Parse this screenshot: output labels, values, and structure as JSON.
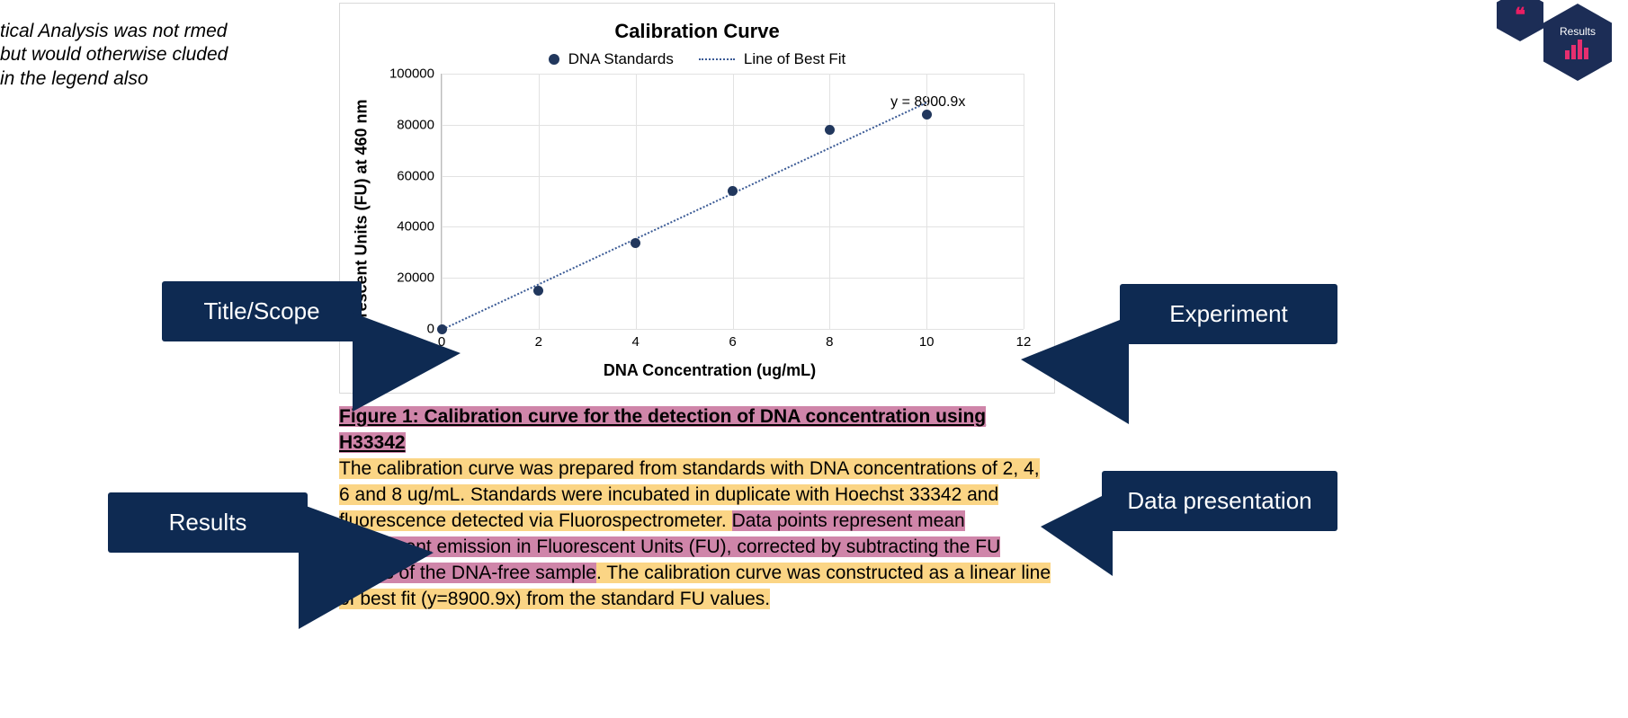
{
  "cut_note": "tical Analysis was not rmed but would otherwise cluded in the legend also",
  "hex_badge_label": "Results",
  "chart": {
    "title": "Calibration Curve",
    "legend": {
      "series_a": "DNA Standards",
      "series_b": "Line of Best Fit"
    },
    "y_label": "Fluorescent Units (FU) at 460 nm",
    "x_label": "DNA Concentration (ug/mL)",
    "equation": "y = 8900.9x",
    "x_ticks": [
      "0",
      "2",
      "4",
      "6",
      "8",
      "10",
      "12"
    ],
    "y_ticks": [
      "0",
      "20000",
      "40000",
      "60000",
      "80000",
      "100000"
    ]
  },
  "chart_data": {
    "type": "scatter",
    "title": "Calibration Curve",
    "xlabel": "DNA Concentration (ug/mL)",
    "ylabel": "Fluorescent Units (FU) at 460 nm",
    "xlim": [
      0,
      12
    ],
    "ylim": [
      0,
      100000
    ],
    "series": [
      {
        "name": "DNA Standards",
        "x": [
          0,
          2,
          4,
          6,
          8,
          10
        ],
        "values": [
          0,
          14800,
          33500,
          54000,
          78000,
          84000
        ]
      },
      {
        "name": "Line of Best Fit",
        "equation": "y = 8900.9x",
        "x": [
          0,
          10
        ],
        "values": [
          0,
          89009
        ]
      }
    ],
    "annotations": [
      {
        "text": "y = 8900.9x",
        "x": 10,
        "y": 89009
      }
    ]
  },
  "caption": {
    "title": "Figure 1: Calibration curve for the detection of DNA concentration using H33342",
    "sent1": "The calibration curve was prepared from standards with DNA concentrations of 2, 4, 6 and 8 ug/mL. Standards were incubated in duplicate with Hoechst 33342 and fluorescence detected via Fluorospectrometer. ",
    "sent2": "Data points represent mean fluorescent emission in Fluorescent Units (FU), corrected by subtracting the FU values of the DNA-free sample",
    "sent3": ". The calibration curve was constructed as a linear line of best fit (y=8900.9x) from the standard FU values."
  },
  "callouts": {
    "title_scope": "Title/Scope",
    "results": "Results",
    "experiment": "Experiment",
    "data_presentation": "Data presentation"
  }
}
